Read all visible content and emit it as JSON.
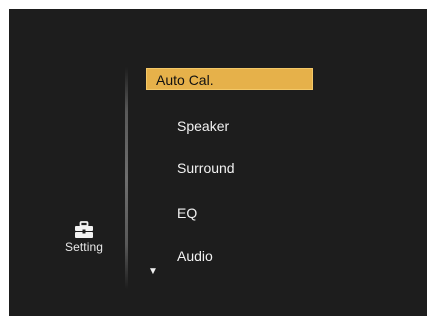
{
  "category": {
    "label": "Setting",
    "icon": "toolbox-icon"
  },
  "menu": {
    "items": [
      {
        "label": "Auto Cal.",
        "selected": true
      },
      {
        "label": "Speaker",
        "selected": false
      },
      {
        "label": "Surround",
        "selected": false
      },
      {
        "label": "EQ",
        "selected": false
      },
      {
        "label": "Audio",
        "selected": false
      }
    ],
    "scroll_indicator": "▼",
    "highlight_color": "#e6b14a"
  }
}
